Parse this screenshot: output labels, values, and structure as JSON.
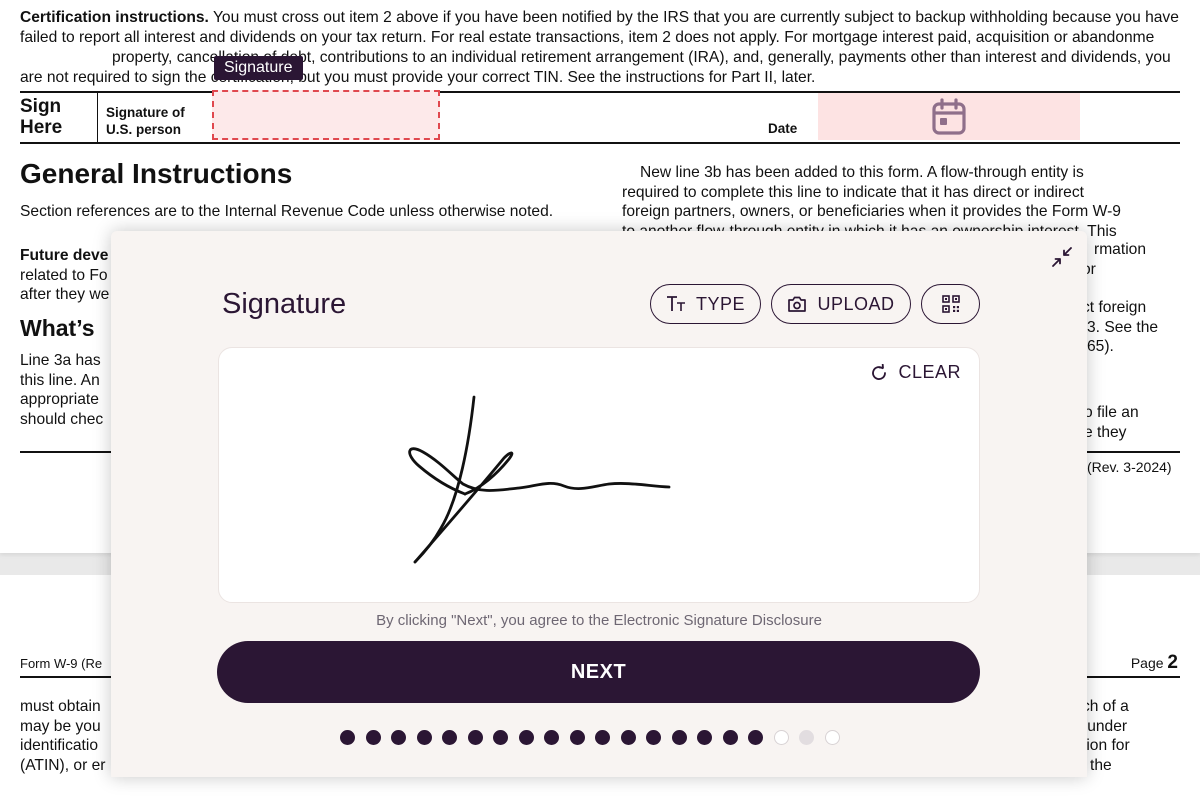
{
  "document": {
    "cert_heading": "Certification instructions.",
    "cert_text_1": " You must cross out item 2 above if you have been notified by the IRS that you are currently subject to backup withholding because you have failed to report all interest and dividends on your tax return. For real estate transactions, item 2 does not apply. For mortgage interest paid, acquisition or abandonme",
    "cert_text_2": "property, cancellation of debt, contributions to an individual retirement arrangement (IRA), and, generally, payments other than interest and divi",
    "cert_text_3": "dends, you are not required to sign the certification, but you must provide your correct TIN. See the instructions for Part II, later.",
    "sign_here": "Sign Here",
    "signature_label_1": "Signature of",
    "signature_label_2": "U.S. person",
    "signature_tooltip": "Signature",
    "date_label": "Date",
    "gi_title": "General Instructions",
    "gi_text": "Section references are to the Internal Revenue Code unless otherwise noted.",
    "future_heading": "Future deve",
    "future_line_1": "related to Fo",
    "future_line_2": "after they we",
    "whats_title": "What’s",
    "line3a_1": "Line 3a has",
    "line3a_2": "this line. An",
    "line3a_3": "appropriate",
    "line3a_4": "should chec",
    "right_col_1": "New line 3b has been added to this form. A flow-through entity is",
    "right_col_2": "required to complete this line to indicate that it has direct or indirect",
    "right_col_3": "foreign partners, owners, or beneficiaries when it provides the Form W-9",
    "right_col_4": "to another flow-through entity in which it has an ownership interest. This",
    "right_frag_1": "rmation",
    "right_frag_2": "or",
    "right_frag_3": "ct foreign",
    "right_frag_4": "3. See the",
    "right_frag_5": "65).",
    "right_frag_6": "o file an",
    "right_frag_7": "e they",
    "rev_text": "(Rev. 3-2024)",
    "footer_left": "Form W-9 (Re",
    "footer_page_label": "Page ",
    "footer_page_num": "2",
    "p2_left_1": "must obtain",
    "p2_left_2": "may be you",
    "p2_left_3": "identificatio",
    "p2_left_4": "(ATIN), or er",
    "p2_right_1": "ch of a",
    "p2_right_2": "(under",
    "p2_right_3": "tion for",
    "p2_right_4": "the"
  },
  "modal": {
    "title": "Signature",
    "type_label": "TYPE",
    "upload_label": "UPLOAD",
    "clear_label": "CLEAR",
    "disclosure": "By clicking \"Next\", you agree to the Electronic Signature Disclosure",
    "next_label": "NEXT",
    "progress": {
      "total": 20,
      "completed": 17,
      "current": 19
    }
  },
  "colors": {
    "brand": "#2b1634",
    "field_highlight": "#fde9ea",
    "field_border": "#e0484f",
    "modal_bg": "#f8f4f2"
  },
  "icons": {
    "collapse": "collapse-arrows-icon",
    "type": "text-type-icon",
    "upload": "camera-icon",
    "qr": "qr-code-icon",
    "clear": "refresh-icon",
    "date": "calendar-icon"
  }
}
